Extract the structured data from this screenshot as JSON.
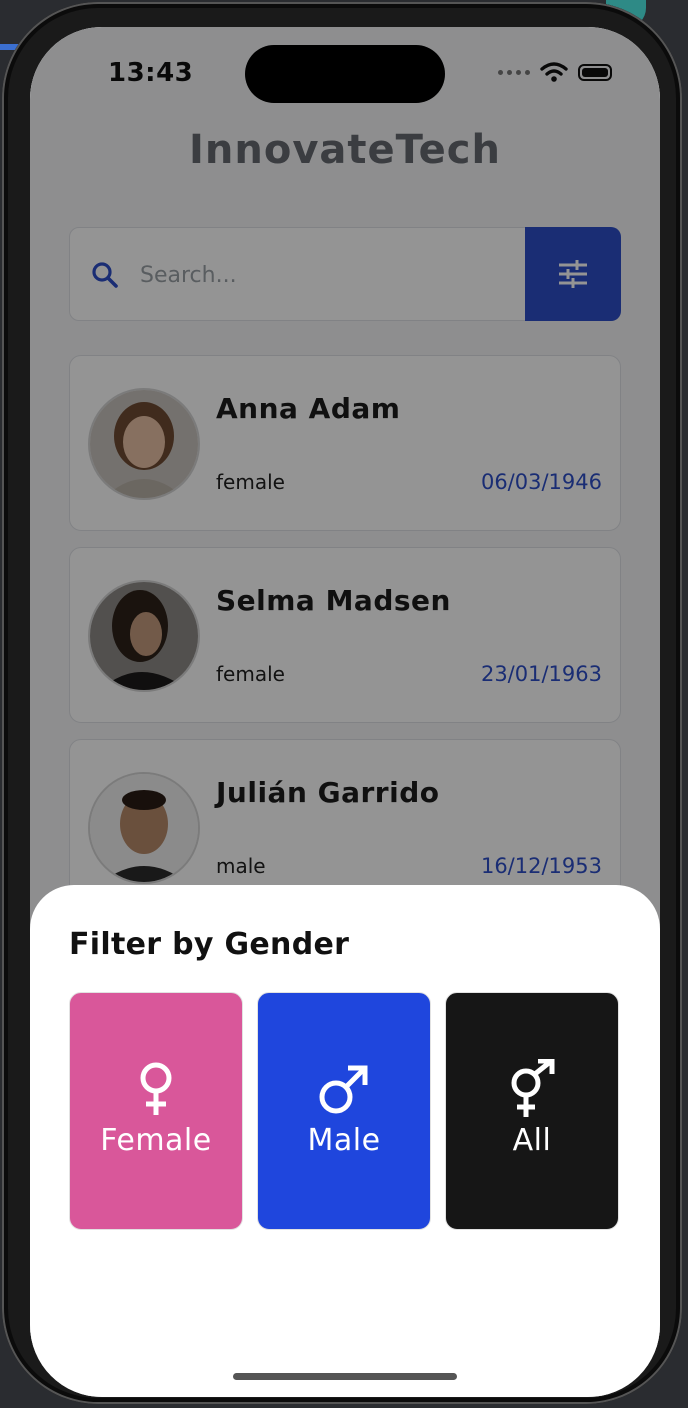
{
  "status_bar": {
    "time": "13:43"
  },
  "app": {
    "title": "InnovateTech"
  },
  "search": {
    "placeholder": "Search..."
  },
  "people": [
    {
      "name": "Anna Adam",
      "gender": "female",
      "birthdate": "06/03/1946"
    },
    {
      "name": "Selma Madsen",
      "gender": "female",
      "birthdate": "23/01/1963"
    },
    {
      "name": "Julián Garrido",
      "gender": "male",
      "birthdate": "16/12/1953"
    }
  ],
  "filter_sheet": {
    "title": "Filter by Gender",
    "options": [
      {
        "label": "Female",
        "icon": "female-symbol-icon",
        "color": "#d9579a"
      },
      {
        "label": "Male",
        "icon": "male-symbol-icon",
        "color": "#1f46dd"
      },
      {
        "label": "All",
        "icon": "all-genders-symbol-icon",
        "color": "#161616"
      }
    ]
  },
  "colors": {
    "accent": "#2e4fc8",
    "date_text": "#2e4fc8"
  }
}
